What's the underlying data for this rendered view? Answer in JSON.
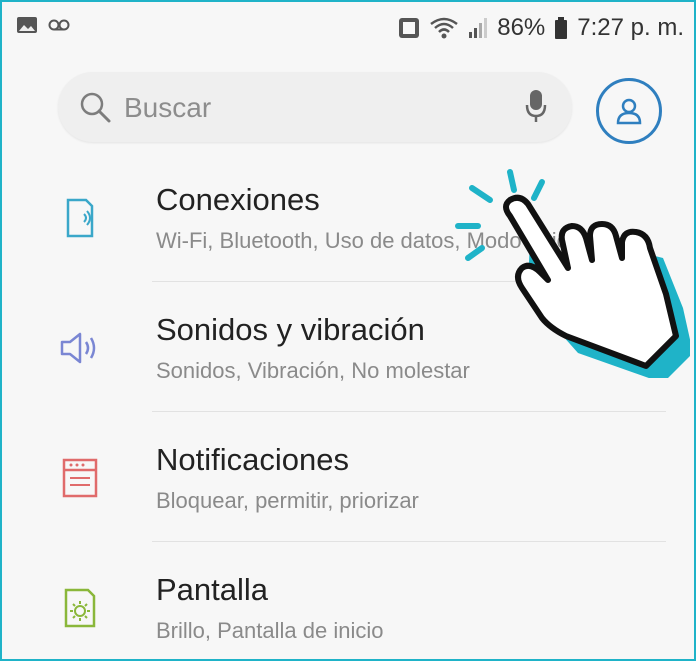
{
  "status_bar": {
    "battery": "86%",
    "time": "7:27 p. m."
  },
  "search": {
    "placeholder": "Buscar"
  },
  "settings": [
    {
      "title": "Conexiones",
      "subtitle": "Wi-Fi, Bluetooth, Uso de datos, Modo Avión…",
      "icon": "connections-icon",
      "color": "#3aa7c9"
    },
    {
      "title": "Sonidos y vibración",
      "subtitle": "Sonidos, Vibración, No molestar",
      "icon": "sound-icon",
      "color": "#7a86d3"
    },
    {
      "title": "Notificaciones",
      "subtitle": "Bloquear, permitir, priorizar",
      "icon": "notifications-icon",
      "color": "#e06b6b"
    },
    {
      "title": "Pantalla",
      "subtitle": "Brillo, Pantalla de inicio",
      "icon": "display-icon",
      "color": "#8ab73a"
    }
  ],
  "colors": {
    "frame": "#1fb3c8",
    "profile": "#2f7fbf"
  }
}
